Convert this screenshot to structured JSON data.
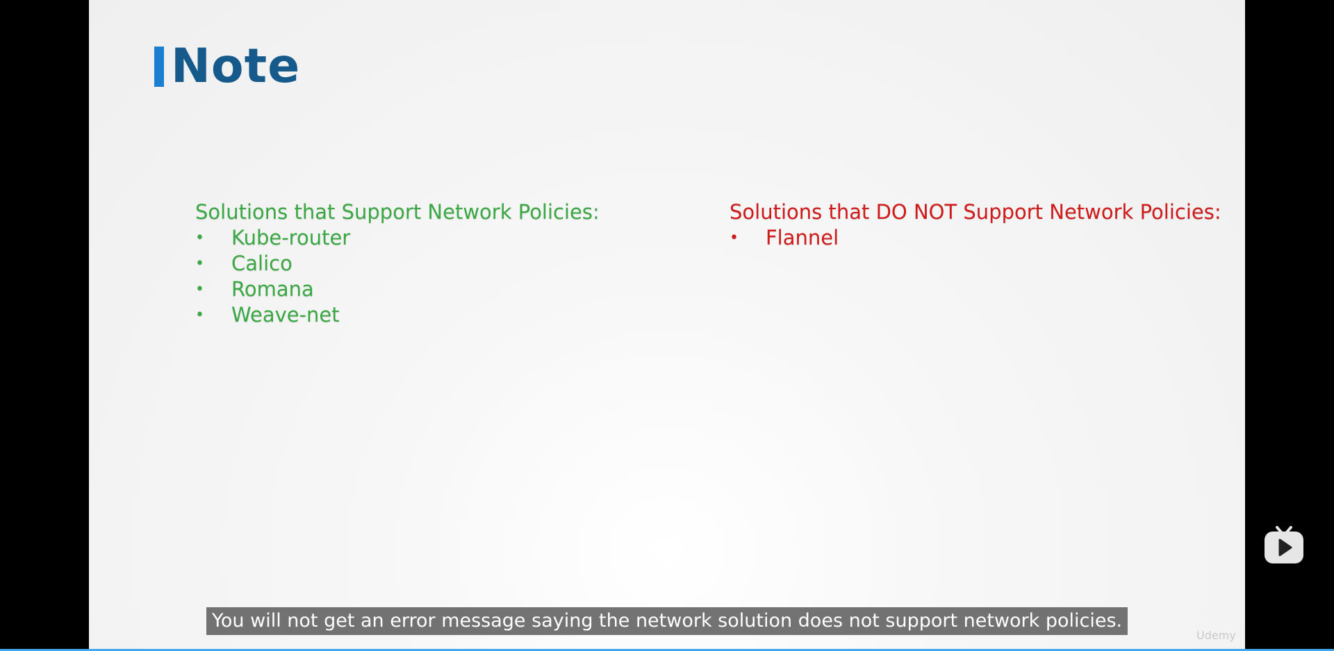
{
  "slide": {
    "title": "Note",
    "supported": {
      "heading": "Solutions that Support Network Policies:",
      "items": [
        "Kube-router",
        "Calico",
        "Romana",
        "Weave-net"
      ],
      "color": "#3aa843"
    },
    "unsupported": {
      "heading": "Solutions that DO NOT Support Network Policies:",
      "items": [
        "Flannel"
      ],
      "color": "#d11a1a"
    },
    "bullet": "•"
  },
  "subtitle": "You will not get an error message saying the network solution does not support network policies.",
  "watermark": "Udemy",
  "player": {
    "play_icon": "tv-play-icon",
    "accent": "#3fa6f0"
  }
}
